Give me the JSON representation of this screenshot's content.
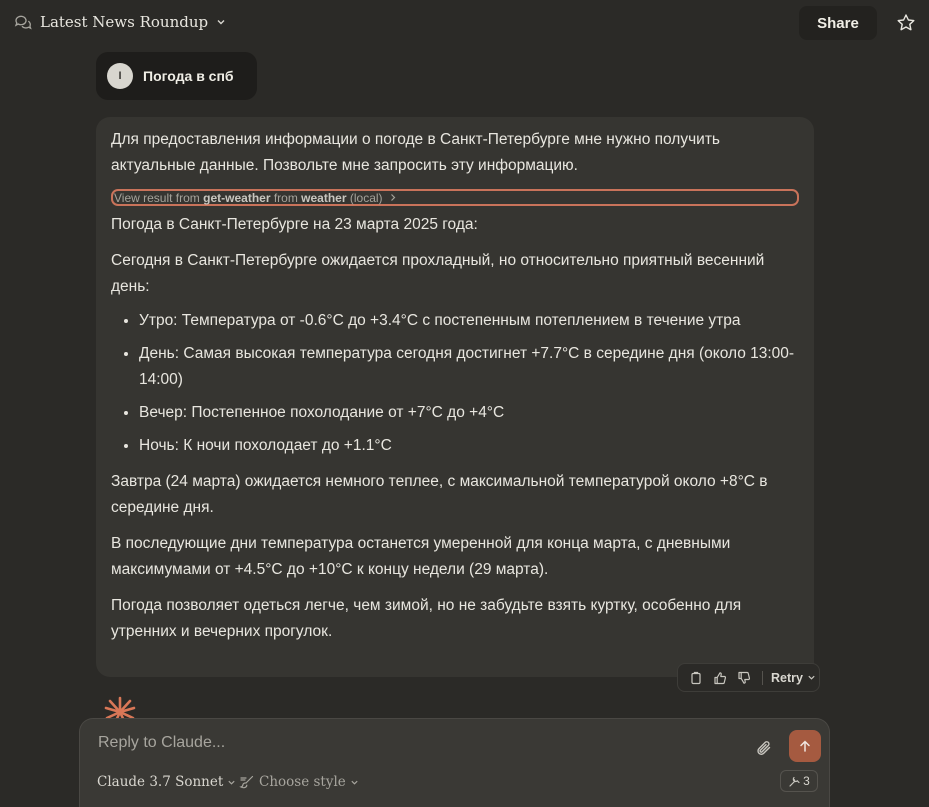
{
  "header": {
    "chat_title": "Latest News Roundup",
    "share_label": "Share"
  },
  "user_message": {
    "avatar_initial": "I",
    "text": "Погода в спб"
  },
  "assistant_message": {
    "intro": "Для предоставления информации о погоде в Санкт-Петербурге мне нужно получить актуальные данные. Позвольте мне запросить эту информацию.",
    "tool_result": {
      "prefix": "View result from ",
      "tool_name": "get-weather",
      "middle": " from ",
      "server_name": "weather",
      "suffix": " (local)"
    },
    "heading": "Погода в Санкт-Петербурге на 23 марта 2025 года:",
    "summary": "Сегодня в Санкт-Петербурге ожидается прохладный, но относительно приятный весенний день:",
    "bullets": [
      "Утро: Температура от -0.6°C до +3.4°C с постепенным потеплением в течение утра",
      "День: Самая высокая температура сегодня достигнет +7.7°C в середине дня (около 13:00-14:00)",
      "Вечер: Постепенное похолодание от +7°C до +4°C",
      "Ночь: К ночи похолодает до +1.1°C"
    ],
    "tomorrow": "Завтра (24 марта) ожидается немного теплее, с максимальной температурой около +8°C в середине дня.",
    "following_days": "В последующие дни температура останется умеренной для конца марта, с дневными максимумами от +4.5°C до +10°C к концу недели (29 марта).",
    "advice": "Погода позволяет одеться легче, чем зимой, но не забудьте взять куртку, особенно для утренних и вечерних прогулок."
  },
  "actions": {
    "retry_label": "Retry"
  },
  "composer": {
    "placeholder": "Reply to Claude...",
    "model_label": "Claude 3.7 Sonnet",
    "style_label": "Choose style",
    "tools_count": "3"
  },
  "colors": {
    "background": "#2b2a27",
    "message_bg": "#363531",
    "accent": "#a55a40",
    "tool_result_border": "#c9735a"
  },
  "icons": {
    "chat": "chat-bubbles-icon",
    "star": "star-icon",
    "copy": "copy-icon",
    "thumbs_up": "thumbs-up-icon",
    "thumbs_down": "thumbs-down-icon",
    "attach": "paperclip-icon",
    "send": "arrow-up-icon",
    "style": "brush-icon",
    "tools": "tools-icon"
  }
}
